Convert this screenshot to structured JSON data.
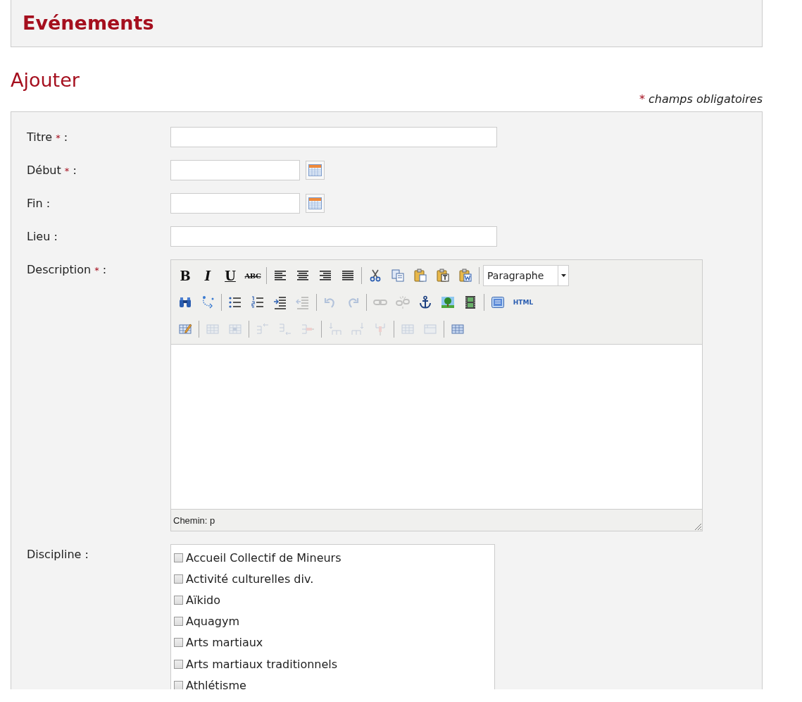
{
  "header": {
    "title": "Evénements"
  },
  "section_title": "Ajouter",
  "legend": {
    "mark": "*",
    "text": "champs obligatoires"
  },
  "fields": [
    {
      "kind": "text",
      "label": "Titre",
      "mark": "*",
      "colon": ":"
    },
    {
      "kind": "date",
      "label": "Début",
      "mark": "*",
      "colon": ":"
    },
    {
      "kind": "date",
      "label": "Fin",
      "colon": ":"
    },
    {
      "kind": "text",
      "label": "Lieu",
      "colon": ":"
    },
    {
      "kind": "editor",
      "label": "Description",
      "mark": "*",
      "colon": ":"
    },
    {
      "kind": "checklist",
      "label": "Discipline",
      "colon": ":"
    }
  ],
  "editor": {
    "toolbar_rows": [
      {
        "items": [
          {
            "kind": "button",
            "label": "B",
            "disabled": false
          },
          {
            "kind": "button",
            "label": "I",
            "disabled": false
          },
          {
            "kind": "button",
            "label": "U",
            "disabled": false
          },
          {
            "kind": "button",
            "label": "ABC",
            "disabled": false
          },
          {
            "kind": "separator"
          },
          {
            "kind": "button",
            "disabled": false
          },
          {
            "kind": "button",
            "disabled": false
          },
          {
            "kind": "button",
            "disabled": false
          },
          {
            "kind": "button",
            "disabled": false
          },
          {
            "kind": "separator"
          },
          {
            "kind": "button",
            "disabled": false
          },
          {
            "kind": "button",
            "disabled": false
          },
          {
            "kind": "button",
            "disabled": false
          },
          {
            "kind": "button",
            "disabled": false
          },
          {
            "kind": "button",
            "disabled": false
          },
          {
            "kind": "separator"
          },
          {
            "kind": "select",
            "value": "Paragraphe"
          }
        ]
      },
      {
        "items": [
          {
            "kind": "button",
            "disabled": false
          },
          {
            "kind": "button",
            "disabled": false
          },
          {
            "kind": "separator"
          },
          {
            "kind": "button",
            "disabled": false
          },
          {
            "kind": "button",
            "disabled": false
          },
          {
            "kind": "button",
            "disabled": false
          },
          {
            "kind": "button",
            "disabled": true
          },
          {
            "kind": "separator"
          },
          {
            "kind": "button",
            "disabled": true
          },
          {
            "kind": "button",
            "disabled": true
          },
          {
            "kind": "separator"
          },
          {
            "kind": "button",
            "disabled": true
          },
          {
            "kind": "button",
            "disabled": true
          },
          {
            "kind": "button",
            "disabled": false
          },
          {
            "kind": "button",
            "disabled": false
          },
          {
            "kind": "button",
            "disabled": false
          },
          {
            "kind": "separator"
          },
          {
            "kind": "button",
            "disabled": false
          },
          {
            "kind": "button",
            "label": "HTML",
            "disabled": false
          }
        ]
      },
      {
        "items": [
          {
            "kind": "button",
            "disabled": false
          },
          {
            "kind": "separator"
          },
          {
            "kind": "button",
            "disabled": true
          },
          {
            "kind": "button",
            "disabled": true
          },
          {
            "kind": "separator"
          },
          {
            "kind": "button",
            "disabled": true
          },
          {
            "kind": "button",
            "disabled": true
          },
          {
            "kind": "button",
            "disabled": true
          },
          {
            "kind": "separator"
          },
          {
            "kind": "button",
            "disabled": true
          },
          {
            "kind": "button",
            "disabled": true
          },
          {
            "kind": "button",
            "disabled": true
          },
          {
            "kind": "separator"
          },
          {
            "kind": "button",
            "disabled": true
          },
          {
            "kind": "button",
            "disabled": true
          },
          {
            "kind": "separator"
          },
          {
            "kind": "button",
            "disabled": false
          }
        ]
      }
    ],
    "path_label": "Chemin: p"
  },
  "disciplines": [
    {
      "label": "Accueil Collectif de Mineurs",
      "checked": false
    },
    {
      "label": "Activité culturelles div.",
      "checked": false
    },
    {
      "label": "Aïkido",
      "checked": false
    },
    {
      "label": "Aquagym",
      "checked": false
    },
    {
      "label": "Arts martiaux",
      "checked": false
    },
    {
      "label": "Arts martiaux traditionnels",
      "checked": false
    },
    {
      "label": "Athlétisme",
      "checked": false
    }
  ]
}
